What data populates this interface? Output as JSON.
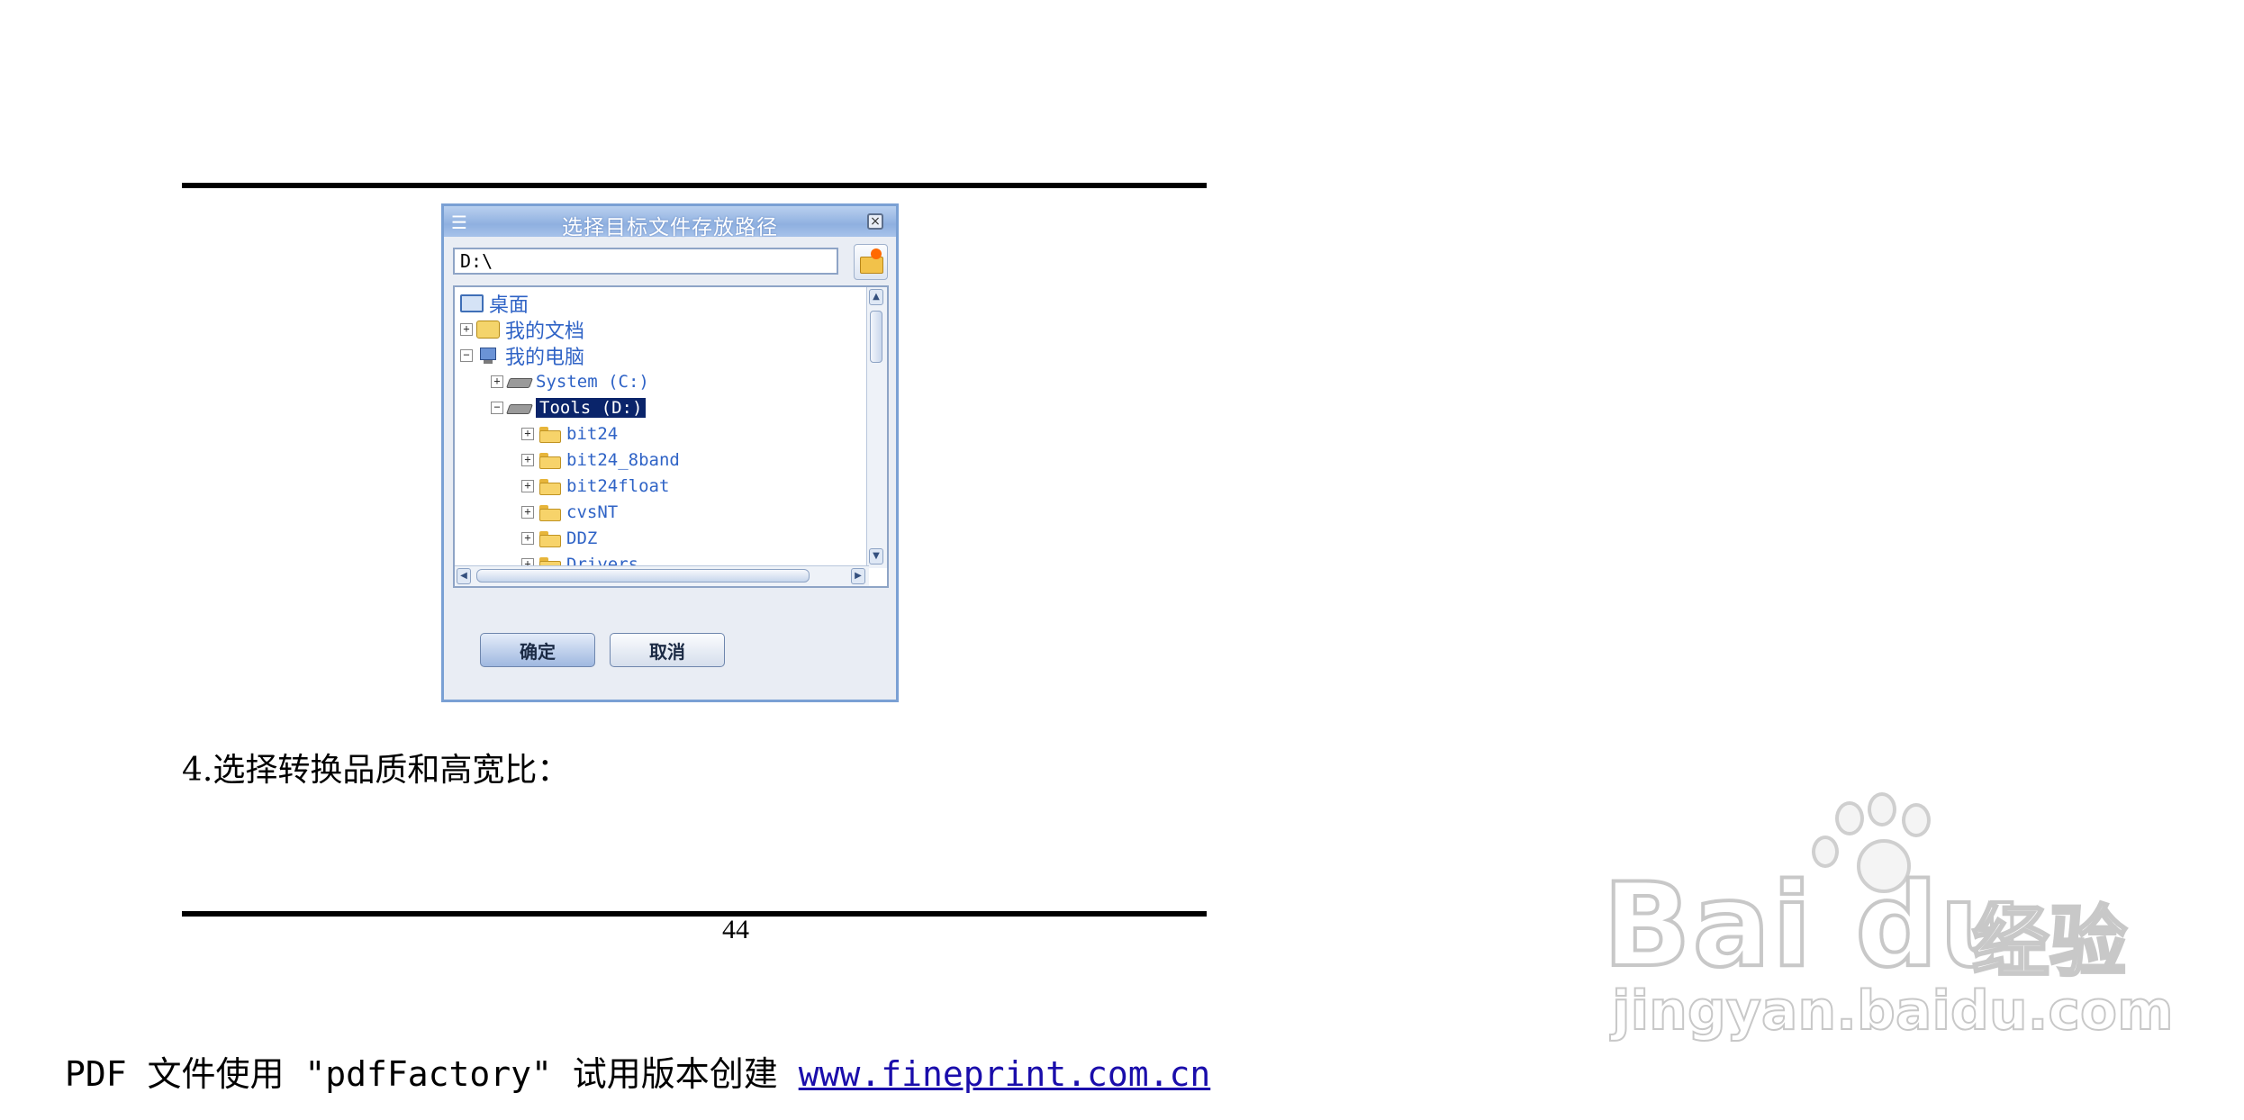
{
  "dialog": {
    "title": "选择目标文件存放路径",
    "menu_glyph": "☰",
    "close_glyph": "×",
    "path_value": "D:\\",
    "tree": [
      {
        "label": "桌面",
        "icon": "desktop-icon",
        "expander": ""
      },
      {
        "label": "我的文档",
        "icon": "documents-icon",
        "expander": "+"
      },
      {
        "label": "我的电脑",
        "icon": "computer-icon",
        "expander": "−"
      },
      {
        "label": "System (C:)",
        "icon": "drive-icon",
        "expander": "+"
      },
      {
        "label": "Tools (D:)",
        "icon": "drive-icon",
        "expander": "−",
        "selected": true
      },
      {
        "label": "bit24",
        "icon": "folder-icon",
        "expander": "+"
      },
      {
        "label": "bit24_8band",
        "icon": "folder-icon",
        "expander": "+"
      },
      {
        "label": "bit24float",
        "icon": "folder-icon",
        "expander": "+"
      },
      {
        "label": "cvsNT",
        "icon": "folder-icon",
        "expander": "+"
      },
      {
        "label": "DDZ",
        "icon": "folder-icon",
        "expander": "+"
      },
      {
        "label": "Drivers",
        "icon": "folder-icon",
        "expander": "+"
      }
    ],
    "ok_label": "确定",
    "cancel_label": "取消"
  },
  "document": {
    "step_text": "4.选择转换品质和高宽比：",
    "page_number": "44"
  },
  "footer": {
    "prefix": "PDF 文件使用 \"pdfFactory\" 试用版本创建 ",
    "link_text": "www.fineprint.com.cn"
  },
  "watermark": {
    "brand": "Bai du",
    "jingyan": "经验",
    "domain": "jingyan.baidu.com"
  },
  "colors": {
    "tree_text": "#2f63c6",
    "selection": "#0a246a",
    "link": "#1a0dab"
  }
}
